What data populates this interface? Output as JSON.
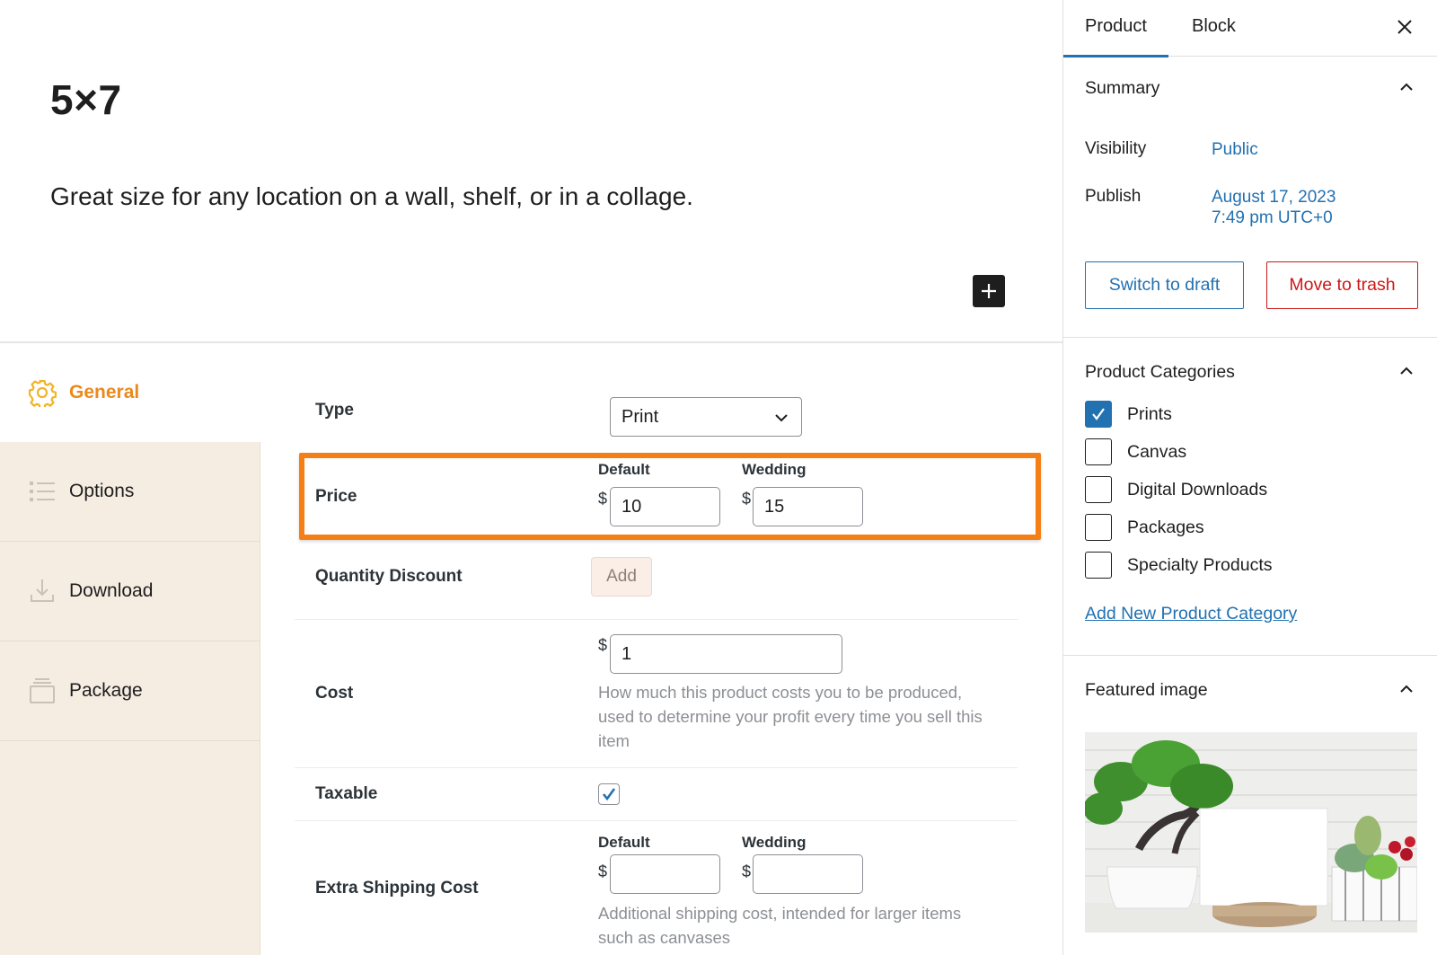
{
  "editor": {
    "title": "5×7",
    "excerpt": "Great size for any location on a wall, shelf, or in a collage.",
    "add_block_icon": "plus-icon"
  },
  "metabox": {
    "tabs": [
      {
        "label": "General",
        "icon": "gear-icon",
        "active": true
      },
      {
        "label": "Options",
        "icon": "list-icon",
        "active": false
      },
      {
        "label": "Download",
        "icon": "download-icon",
        "active": false
      },
      {
        "label": "Package",
        "icon": "package-icon",
        "active": false
      }
    ],
    "type": {
      "label": "Type",
      "value": "Print"
    },
    "price": {
      "label": "Price",
      "currency": "$",
      "columns": [
        {
          "label": "Default",
          "value": "10"
        },
        {
          "label": "Wedding",
          "value": "15"
        }
      ]
    },
    "quantity_discount": {
      "label": "Quantity Discount",
      "button": "Add"
    },
    "cost": {
      "label": "Cost",
      "currency": "$",
      "value": "1",
      "help": "How much this product costs you to be produced, used to determine your profit every time you sell this item"
    },
    "taxable": {
      "label": "Taxable",
      "checked": true
    },
    "extra_shipping": {
      "label": "Extra Shipping Cost",
      "currency": "$",
      "columns": [
        {
          "label": "Default",
          "value": ""
        },
        {
          "label": "Wedding",
          "value": ""
        }
      ],
      "help": "Additional shipping cost, intended for larger items such as canvases"
    },
    "highlight_color": "#f57f17",
    "accent_color": "#ea8a1c"
  },
  "sidebar": {
    "tabs": [
      {
        "label": "Product",
        "active": true
      },
      {
        "label": "Block",
        "active": false
      }
    ],
    "summary": {
      "title": "Summary",
      "visibility_label": "Visibility",
      "visibility_value": "Public",
      "publish_label": "Publish",
      "publish_date": "August 17, 2023",
      "publish_time": "7:49 pm UTC+0",
      "switch_draft": "Switch to draft",
      "move_trash": "Move to trash"
    },
    "categories": {
      "title": "Product Categories",
      "items": [
        {
          "label": "Prints",
          "checked": true
        },
        {
          "label": "Canvas",
          "checked": false
        },
        {
          "label": "Digital Downloads",
          "checked": false
        },
        {
          "label": "Packages",
          "checked": false
        },
        {
          "label": "Specialty Products",
          "checked": false
        }
      ],
      "add_new": "Add New Product Category"
    },
    "featured_image": {
      "title": "Featured image",
      "description": "Bonsai tree, blank white card on wood slice, succulents in white fence planter"
    },
    "link_color": "#2271b1",
    "danger_color": "#cc1818"
  }
}
